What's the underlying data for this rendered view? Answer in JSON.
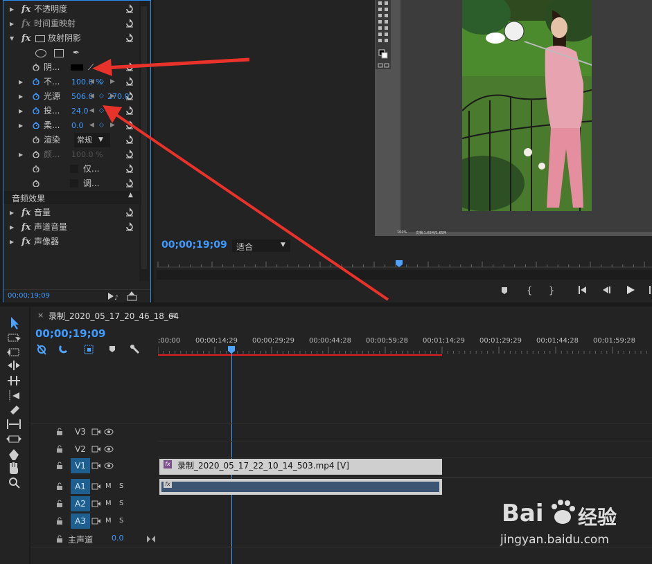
{
  "effect_controls": {
    "rows": [
      {
        "label": "不透明度",
        "type": "fx"
      },
      {
        "label": "时间重映射",
        "type": "fx-dim"
      },
      {
        "label": "放射阴影",
        "type": "fx-open"
      },
      {
        "label": "阴...",
        "type": "param"
      },
      {
        "label": "不...",
        "value": "100.0 %",
        "type": "param-tri"
      },
      {
        "label": "光源",
        "value": "506.0",
        "value2": "270.0",
        "type": "param-tri"
      },
      {
        "label": "投...",
        "value": "24.0",
        "type": "param-tri"
      },
      {
        "label": "柔...",
        "value": "0.0",
        "type": "param-tri"
      },
      {
        "label": "渲染",
        "value": "常规",
        "type": "param"
      },
      {
        "label": "颜...",
        "value": "100.0 %",
        "type": "param-tri-dim"
      },
      {
        "label": "仅...",
        "type": "param-check"
      },
      {
        "label": "调...",
        "type": "param-check"
      }
    ],
    "audio_section": "音频效果",
    "audio_rows": [
      "音量",
      "声道音量",
      "声像器"
    ],
    "timecode": "00;00;19;09"
  },
  "program_monitor": {
    "timecode": "00;00;19;09",
    "fit": "适合",
    "ps_status": "100%",
    "ps_doc": "文档:1.65M/1.65M"
  },
  "timeline": {
    "sequence_name": "录制_2020_05_17_20_46_18_64",
    "menu_glyph": "≡",
    "close_glyph": "×",
    "timecode": "00;00;19;09",
    "ruler_labels": [
      ";00;00",
      "00;00;14;29",
      "00;00;29;29",
      "00;00;44;28",
      "00;00;59;28",
      "00;01;14;29",
      "00;01;29;29",
      "00;01;44;28",
      "00;01;59;28"
    ],
    "tracks": [
      {
        "name": "V3",
        "selected": false
      },
      {
        "name": "V2",
        "selected": false
      },
      {
        "name": "V1",
        "selected": true
      },
      {
        "name": "A1",
        "selected": true
      },
      {
        "name": "A2",
        "selected": true
      },
      {
        "name": "A3",
        "selected": true
      }
    ],
    "track_letters": [
      "M",
      "S"
    ],
    "master_label": "主声道",
    "master_value": "0.0",
    "clip_label": "录制_2020_05_17_22_10_14_503.mp4 [V]",
    "fx_badge": "fx"
  },
  "watermark": {
    "brand": "Bai",
    "brand2": "经验",
    "url": "jingyan.baidu.com"
  },
  "colors": {
    "accent": "#2d8ceb",
    "arrow": "#e8322a",
    "timecode": "#3f9bff"
  }
}
